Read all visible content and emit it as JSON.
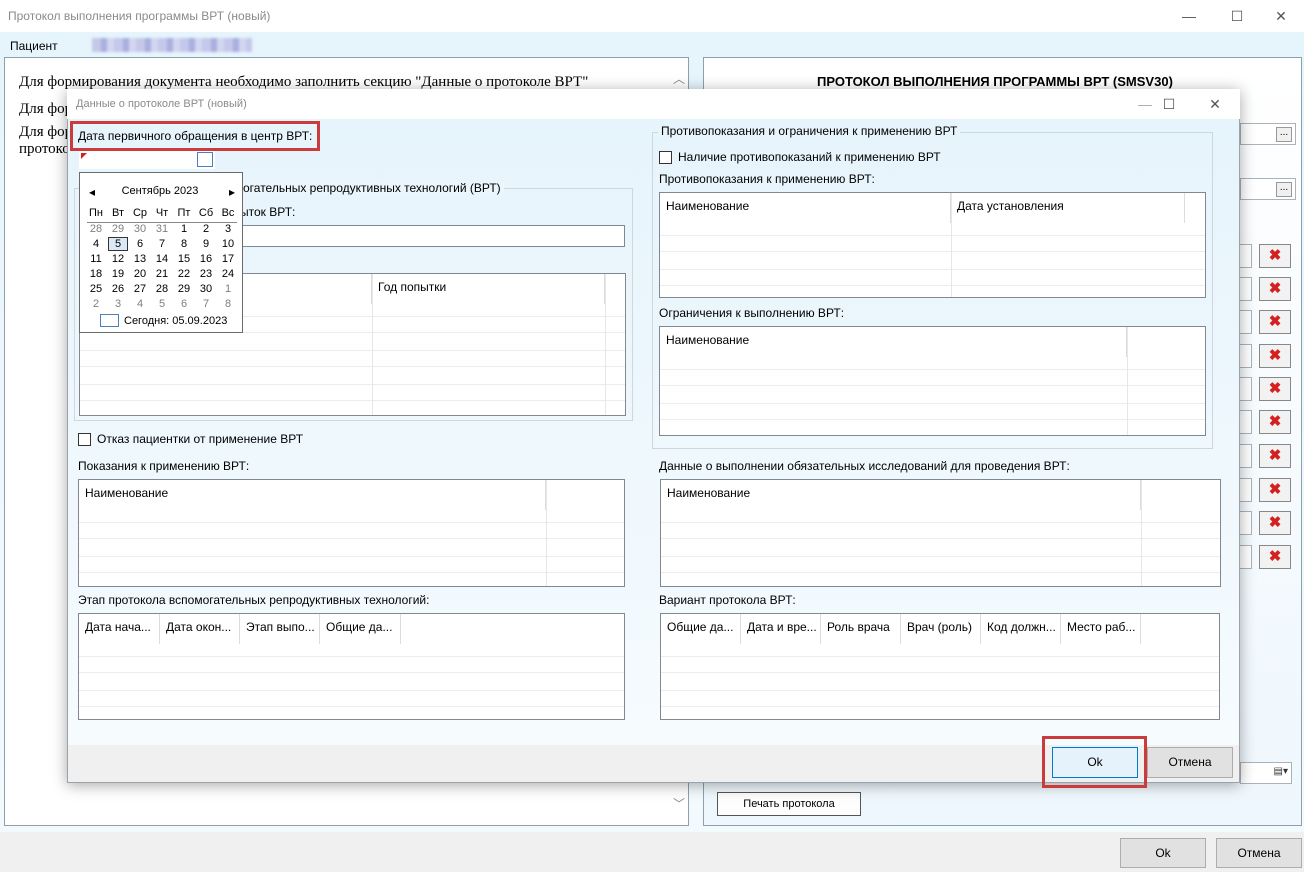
{
  "outer": {
    "title": "Протокол выполнения программы ВРТ (новый)",
    "patient_label": "Пациент",
    "doc_line1": "Для формирования документа необходимо заполнить секцию \"Данные о протоколе ВРТ\"",
    "doc_line2": "Для фор",
    "doc_line3": "Для фор",
    "doc_line4": "протоко",
    "right_title": "ПРОТОКОЛ ВЫПОЛНЕНИЯ ПРОГРАММЫ ВРТ (SMSV30)",
    "dots_label": "...",
    "print_button": "Печать протокола",
    "ok_button": "Ok",
    "cancel_button": "Отмена"
  },
  "modal": {
    "title": "Данные о протоколе ВРТ (новый)",
    "first_visit_label": "Дата первичного обращения в центр ВРТ:",
    "vrt_group_partial": "огательных репродуктивных технологий (ВРТ)",
    "attempts_label_partial": "ыток ВРТ:",
    "attempt_year_col": "Год попытки",
    "refusal_label": "Отказ пациентки от применение ВРТ",
    "indications_label": "Показания к применению ВРТ:",
    "indications_col": "Наименование",
    "stage_label": "Этап протокола вспомогательных репродуктивных технологий:",
    "stage_cols": [
      "Дата нача...",
      "Дата окон...",
      "Этап выпо...",
      "Общие да..."
    ],
    "contra_group_title": "Противопоказания и ограничения к применению ВРТ",
    "contra_checkbox": "Наличие противопоказаний к применению ВРТ",
    "contra_label": "Противопоказания к применению ВРТ:",
    "contra_cols": [
      "Наименование",
      "Дата установления"
    ],
    "limits_label": "Ограничения к выполнению ВРТ:",
    "limits_col": "Наименование",
    "exams_label": "Данные о выполнении обязательных исследований для проведения ВРТ:",
    "exams_col": "Наименование",
    "variant_label": "Вариант протокола ВРТ:",
    "variant_cols": [
      "Общие да...",
      "Дата и вре...",
      "Роль врача",
      "Врач (роль)",
      "Код должн...",
      "Место раб..."
    ],
    "ok_button": "Ok",
    "cancel_button": "Отмена"
  },
  "calendar": {
    "month_label": "Сентябрь 2023",
    "prev_arrow": "◂",
    "next_arrow": "▸",
    "weekdays": [
      "Пн",
      "Вт",
      "Ср",
      "Чт",
      "Пт",
      "Сб",
      "Вс"
    ],
    "weeks": [
      [
        "28",
        "29",
        "30",
        "31",
        "1",
        "2",
        "3"
      ],
      [
        "4",
        "5",
        "6",
        "7",
        "8",
        "9",
        "10"
      ],
      [
        "11",
        "12",
        "13",
        "14",
        "15",
        "16",
        "17"
      ],
      [
        "18",
        "19",
        "20",
        "21",
        "22",
        "23",
        "24"
      ],
      [
        "25",
        "26",
        "27",
        "28",
        "29",
        "30",
        "1"
      ],
      [
        "2",
        "3",
        "4",
        "5",
        "6",
        "7",
        "8"
      ]
    ],
    "today_label": "Сегодня: 05.09.2023",
    "selected_day": "5"
  },
  "colors": {
    "highlight": "#cc3b3b",
    "today_box": "#4a7fc1",
    "delete_icon": "#d42020"
  }
}
